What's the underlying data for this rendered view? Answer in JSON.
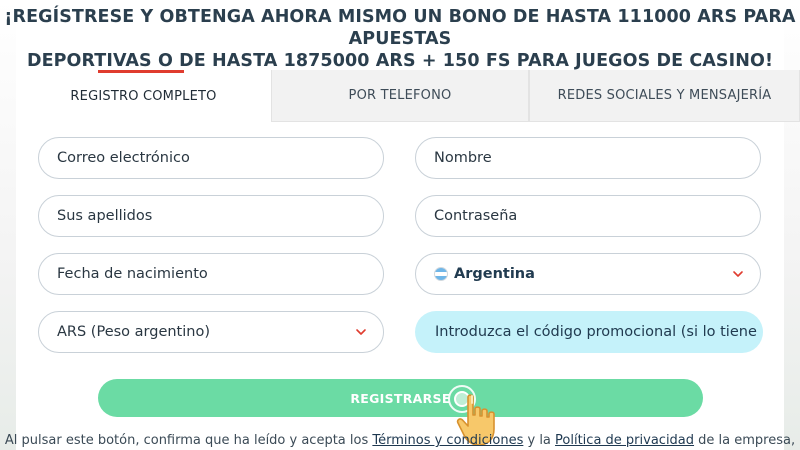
{
  "headline": {
    "line1": "¡REGÍSTRESE Y OBTENGA AHORA MISMO UN BONO DE HASTA 111000 ARS PARA APUESTAS",
    "line2": "DEPORTIVAS O DE HASTA 1875000 ARS + 150 FS PARA JUEGOS DE CASINO!"
  },
  "tabs": [
    {
      "label": "REGISTRO COMPLETO",
      "active": true
    },
    {
      "label": "POR TELEFONO",
      "active": false
    },
    {
      "label": "REDES SOCIALES Y MENSAJERÍA",
      "active": false
    }
  ],
  "form": {
    "email_placeholder": "Correo electrónico",
    "name_placeholder": "Nombre",
    "surname_placeholder": "Sus apellidos",
    "password_placeholder": "Contraseña",
    "birthdate_placeholder": "Fecha de nacimiento",
    "country": {
      "value": "Argentina",
      "flag": "argentina-flag-icon"
    },
    "currency": {
      "value": "ARS (Peso argentino)"
    },
    "promo_placeholder": "Introduzca el código promocional (si lo tiene"
  },
  "register_button": {
    "label": "REGISTRARSE"
  },
  "terms": {
    "prefix": "Al pulsar este botón, confirma que ha leído y acepta los ",
    "link1": "Términos y condiciones",
    "middle": " y la ",
    "link2": "Política de privacidad",
    "suffix": " de la empresa,"
  },
  "colors": {
    "accent_red": "#e03c2f",
    "register_green": "#6bdba4",
    "promo_cyan": "#c5f2fa",
    "headline_text": "#2b3f4e"
  }
}
